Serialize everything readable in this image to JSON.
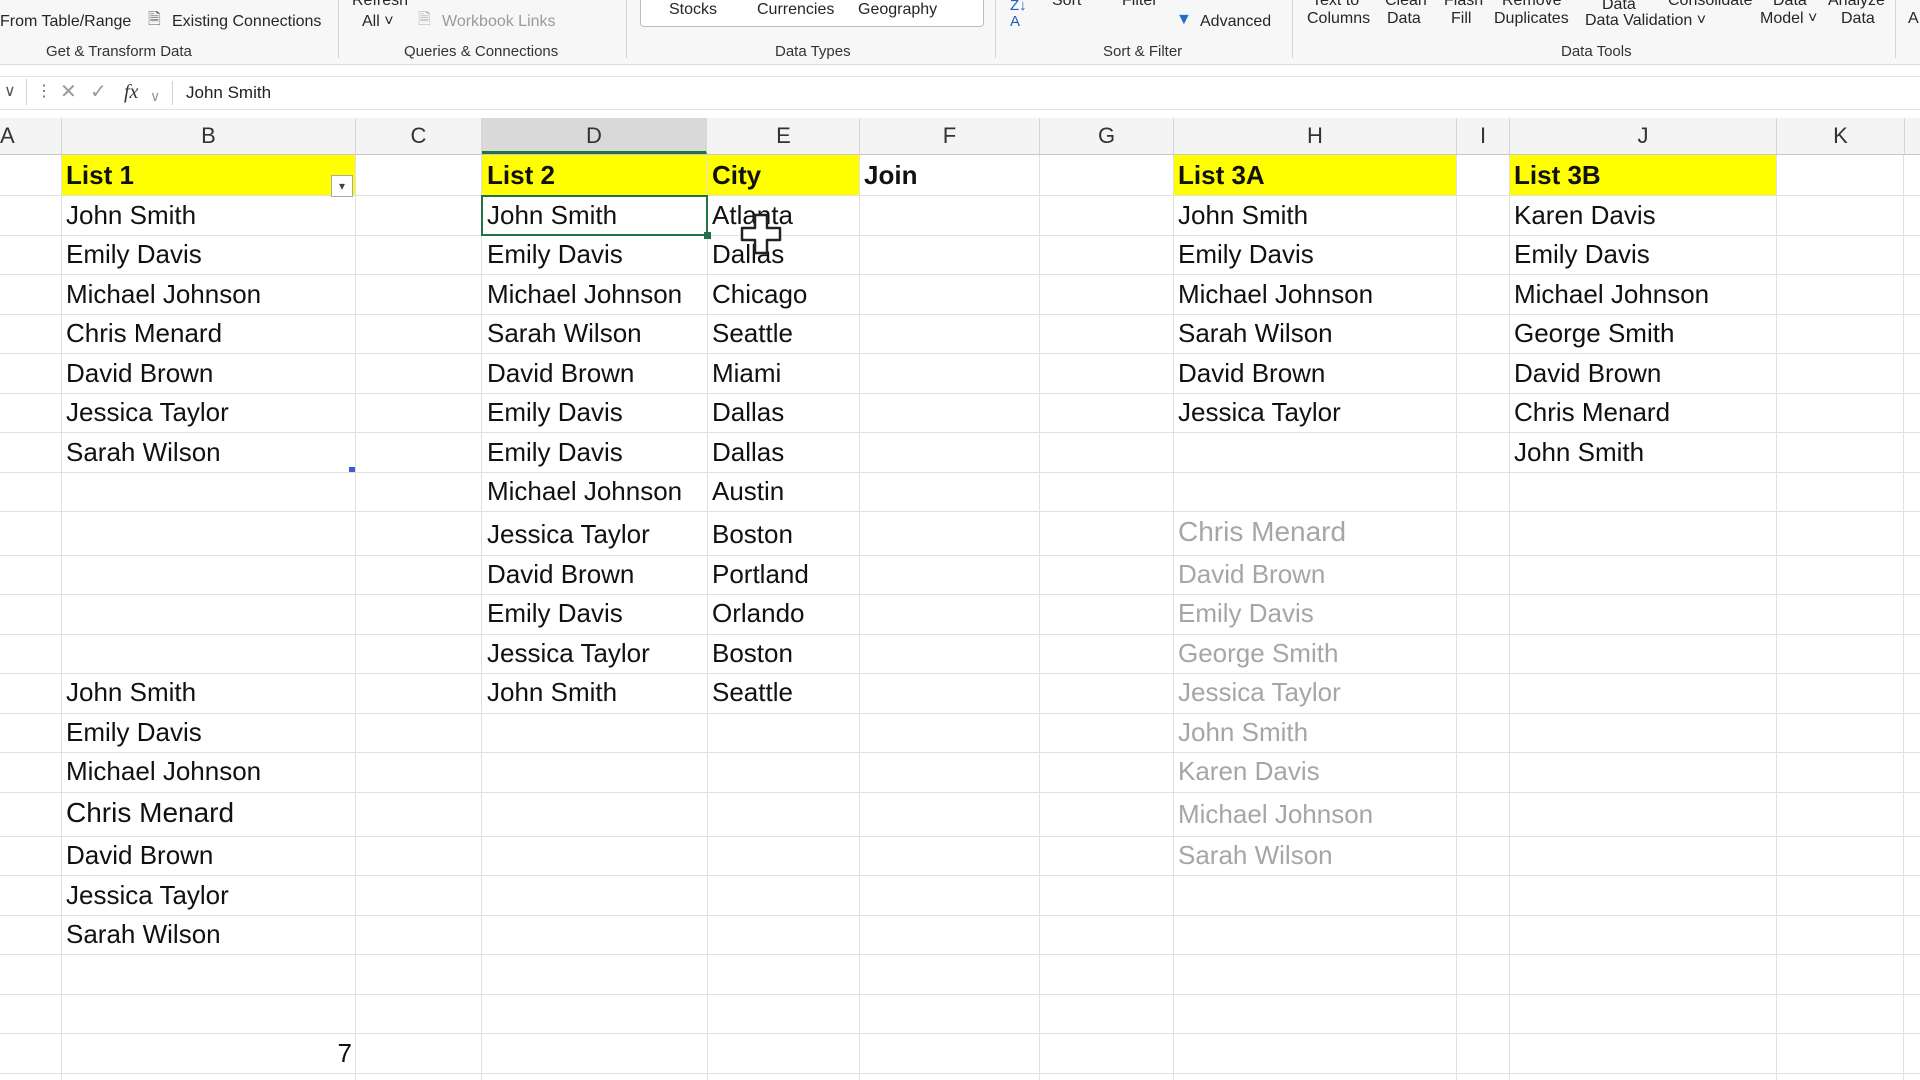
{
  "ribbon": {
    "from_table": "From Table/Range",
    "existing_connections": "Existing Connections",
    "refresh_top": "Refresh",
    "refresh_all": "All",
    "workbook_links": "Workbook Links",
    "stocks": "Stocks",
    "currencies": "Currencies",
    "geography": "Geography",
    "sort": "Sort",
    "filter": "Filter",
    "advanced": "Advanced",
    "text_to_top": "Text to",
    "text_to_columns": "Columns",
    "clean_top": "Clean",
    "clean_data": "Data",
    "flash_top": "Flash",
    "flash_fill": "Fill",
    "remove_top": "Remove",
    "remove_duplicates": "Duplicates",
    "data_top": "Data",
    "data_validation": "Data Validation",
    "consolidate": "Consolidate",
    "data_model_top": "Data",
    "data_model": "Model",
    "analyze_top": "Analyze",
    "analyze_data": "Data",
    "groups": {
      "get_transform": "Get & Transform Data",
      "queries": "Queries & Connections",
      "data_types": "Data Types",
      "sort_filter": "Sort & Filter",
      "data_tools": "Data Tools"
    }
  },
  "formula_bar": {
    "value": "John Smith"
  },
  "columns": [
    "A",
    "B",
    "C",
    "D",
    "E",
    "F",
    "G",
    "H",
    "I",
    "J",
    "K"
  ],
  "sheet": {
    "list1_header": "List 1",
    "list2_header": "List 2",
    "city_header": "City",
    "join_header": "Join",
    "list3a_header": "List 3A",
    "list3b_header": "List 3B",
    "list1": [
      "John Smith",
      "Emily Davis",
      "Michael Johnson",
      "Chris Menard",
      "David Brown",
      "Jessica Taylor",
      "Sarah Wilson"
    ],
    "list1_copy": [
      "John Smith",
      "Emily Davis",
      "Michael Johnson",
      "Chris Menard",
      "David Brown",
      "Jessica Taylor",
      "Sarah Wilson"
    ],
    "list2": [
      "John Smith",
      "Emily Davis",
      "Michael Johnson",
      "Sarah Wilson",
      "David Brown",
      "Emily Davis",
      "Emily Davis",
      "Michael Johnson",
      "Jessica Taylor",
      "David Brown",
      "Emily Davis",
      "Jessica Taylor",
      "John Smith"
    ],
    "cities": [
      "Atlanta",
      "Dallas",
      "Chicago",
      "Seattle",
      "Miami",
      "Dallas",
      "Dallas",
      "Austin",
      "Boston",
      "Portland",
      "Orlando",
      "Boston",
      "Seattle"
    ],
    "list3a": [
      "John Smith",
      "Emily Davis",
      "Michael Johnson",
      "Sarah Wilson",
      "David Brown",
      "Jessica Taylor"
    ],
    "list3a_sorted": [
      "Chris Menard",
      "David Brown",
      "Emily Davis",
      "George Smith",
      "Jessica Taylor",
      "John Smith",
      "Karen Davis",
      "Michael Johnson",
      "Sarah Wilson"
    ],
    "list3b": [
      "Karen Davis",
      "Emily Davis",
      "Michael Johnson",
      "George Smith",
      "David Brown",
      "Chris Menard",
      "John Smith"
    ],
    "count": "7"
  }
}
